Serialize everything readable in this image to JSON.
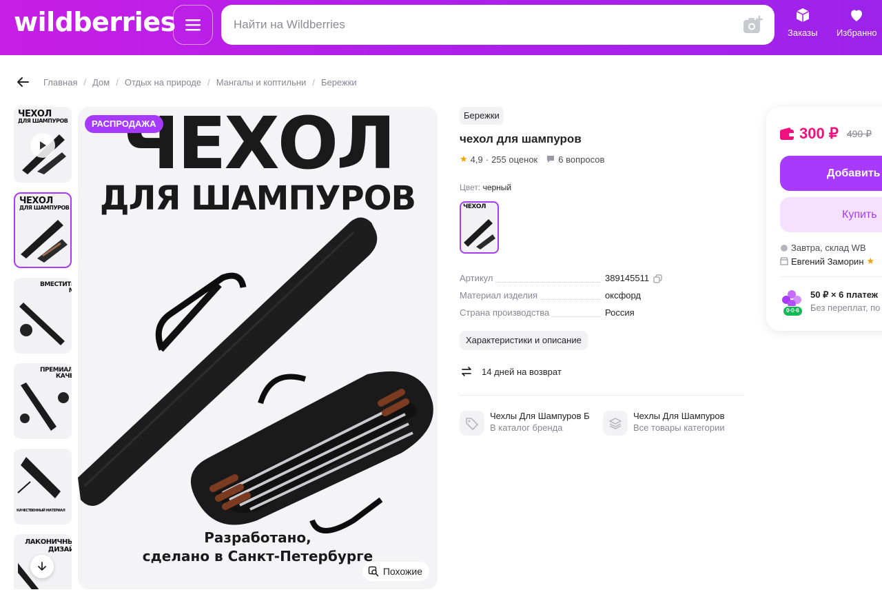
{
  "header": {
    "logo": "wildberries",
    "search_placeholder": "Найти на Wildberries",
    "orders_label": "Заказы",
    "favorites_label": "Избранно",
    "accent": "#a73afd"
  },
  "breadcrumbs": [
    "Главная",
    "Дом",
    "Отдых на природе",
    "Мангалы и коптильни",
    "Бережки"
  ],
  "gallery": {
    "thumbs": [
      {
        "title": "ЧЕХОЛ",
        "subtitle": "ДЛЯ ШАМПУРОВ",
        "video": true
      },
      {
        "title": "ЧЕХОЛ",
        "subtitle": "ДЛЯ ШАМПУРОВ",
        "active": true
      },
      {
        "title": "ВМЕСТИТЕЛЬНАЯ МОДЕЛЬ"
      },
      {
        "title": "ПРЕМИАЛЬНОЕ КАЧЕСТВО"
      },
      {
        "title": "КАЧЕСТВЕННЫЙ МАТЕРИАЛ"
      },
      {
        "title": "ЛАКОНИЧНЫЙ ДИЗАЙН"
      }
    ],
    "main": {
      "badge": "РАСПРОДАЖА",
      "title_line1": "ЧЕХОЛ",
      "title_line2": "ДЛЯ ШАМПУРОВ",
      "caption_line1": "Разработано,",
      "caption_line2": "сделано в Санкт-Петербурге",
      "similar_label": "Похожие"
    }
  },
  "product": {
    "brand": "Бережки",
    "title": "чехол для шампуров",
    "rating": "4,9",
    "reviews": "255 оценок",
    "questions": "6 вопросов",
    "color_label": "Цвет:",
    "color_value": "черный",
    "params": [
      {
        "name": "Артикул",
        "value": "389145511"
      },
      {
        "name": "Материал изделия",
        "value": "оксфорд"
      },
      {
        "name": "Страна производства",
        "value": "Россия"
      }
    ],
    "chars_button": "Характеристики и описание",
    "return_policy": "14 дней на возврат",
    "links": [
      {
        "title": "Чехлы Для Шампуров Б",
        "subtitle": "В каталог бренда"
      },
      {
        "title": "Чехлы Для Шампуров",
        "subtitle": "Все товары категории"
      }
    ]
  },
  "buy": {
    "price": "300 ₽",
    "old_price": "490 ₽",
    "price_color": "#f1117e",
    "add_label": "Добавить",
    "buy_label": "Купить",
    "delivery": "Завтра, склад WB",
    "seller": "Евгений Заморин",
    "installment_title": "50 ₽ × 6 платеж",
    "installment_sub": "Без переплат, по",
    "installment_badge": "0·0·6"
  }
}
